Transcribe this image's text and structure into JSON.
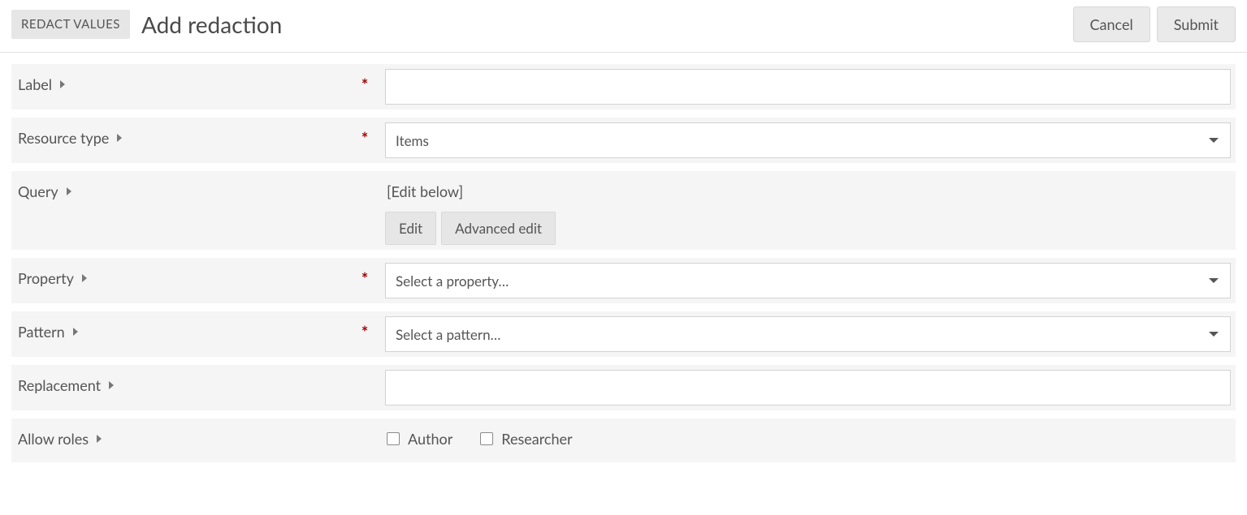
{
  "header": {
    "badge": "REDACT VALUES",
    "title": "Add redaction",
    "cancel_label": "Cancel",
    "submit_label": "Submit"
  },
  "required_symbol": "*",
  "fields": {
    "label": {
      "label": "Label",
      "required": true,
      "value": ""
    },
    "resource_type": {
      "label": "Resource type",
      "required": true,
      "value": "Items"
    },
    "query": {
      "label": "Query",
      "required": false,
      "hint": "[Edit below]",
      "edit_label": "Edit",
      "advanced_label": "Advanced edit"
    },
    "property": {
      "label": "Property",
      "required": true,
      "placeholder": "Select a property…"
    },
    "pattern": {
      "label": "Pattern",
      "required": true,
      "placeholder": "Select a pattern…"
    },
    "replacement": {
      "label": "Replacement",
      "required": false,
      "value": ""
    },
    "allow_roles": {
      "label": "Allow roles",
      "required": false,
      "options": [
        "Author",
        "Researcher"
      ]
    }
  }
}
